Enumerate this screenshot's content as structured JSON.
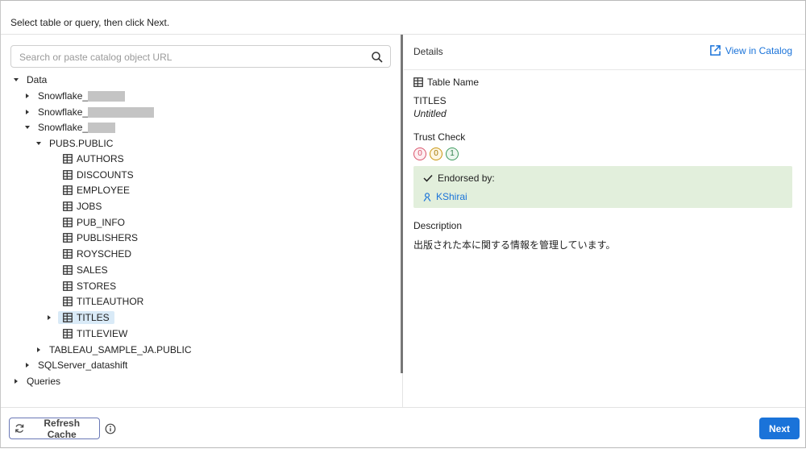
{
  "instruction": "Select table or query, then click Next.",
  "search": {
    "placeholder": "Search or paste catalog object URL",
    "value": ""
  },
  "tree": {
    "data": "Data",
    "sources": [
      "Snowflake_",
      "Snowflake_",
      "Snowflake_"
    ],
    "schema": "PUBS.PUBLIC",
    "tables": [
      "AUTHORS",
      "DISCOUNTS",
      "EMPLOYEE",
      "JOBS",
      "PUB_INFO",
      "PUBLISHERS",
      "ROYSCHED",
      "SALES",
      "STORES",
      "TITLEAUTHOR",
      "TITLES",
      "TITLEVIEW"
    ],
    "schema2": "TABLEAU_SAMPLE_JA.PUBLIC",
    "sqlserver": "SQLServer_datashift",
    "queries": "Queries"
  },
  "details": {
    "header": "Details",
    "view_in_catalog": "View in Catalog",
    "table_name_label": "Table Name",
    "table_name": "TITLES",
    "table_caption": "Untitled",
    "trust_check_label": "Trust Check",
    "trust_badges": [
      "0",
      "0",
      "1"
    ],
    "endorsed_by_label": "Endorsed by:",
    "endorser": "KShirai",
    "description_label": "Description",
    "description": "出版された本に関する情報を管理しています。"
  },
  "footer": {
    "refresh_label": "Refresh Cache",
    "next_label": "Next"
  },
  "colors": {
    "accent": "#1a73d9",
    "selected_bg": "#d9eaf7",
    "endorse_bg": "#e2efdc"
  }
}
